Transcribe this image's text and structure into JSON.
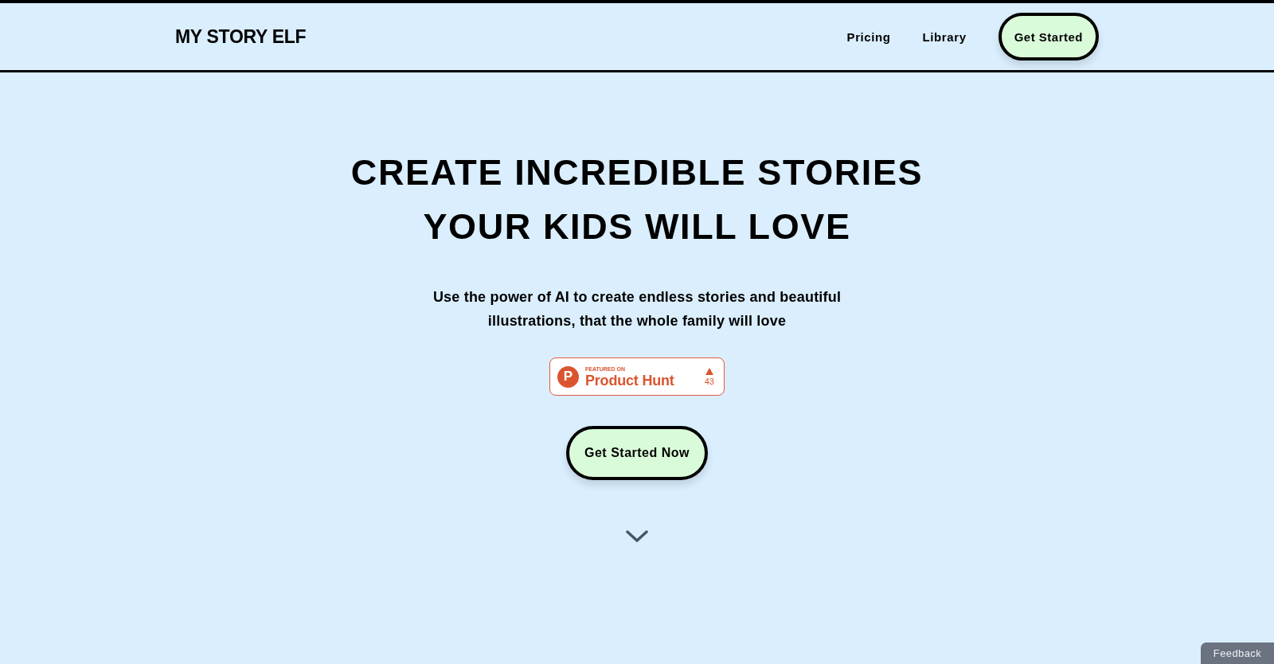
{
  "header": {
    "logo": "MY STORY ELF",
    "nav": [
      "Pricing",
      "Library"
    ],
    "cta": "Get Started"
  },
  "hero": {
    "title_lines": [
      "CREATE INCREDIBLE STORIES",
      "YOUR KIDS WILL LOVE"
    ],
    "subtitle": "Use the power of AI to create endless stories and beautiful illustrations, that the whole family will love",
    "badge": {
      "logo_letter": "P",
      "kicker": "FEATURED ON",
      "name": "Product Hunt",
      "count": "43"
    },
    "cta": "Get Started Now"
  },
  "feedback_tab": "Feedback"
}
